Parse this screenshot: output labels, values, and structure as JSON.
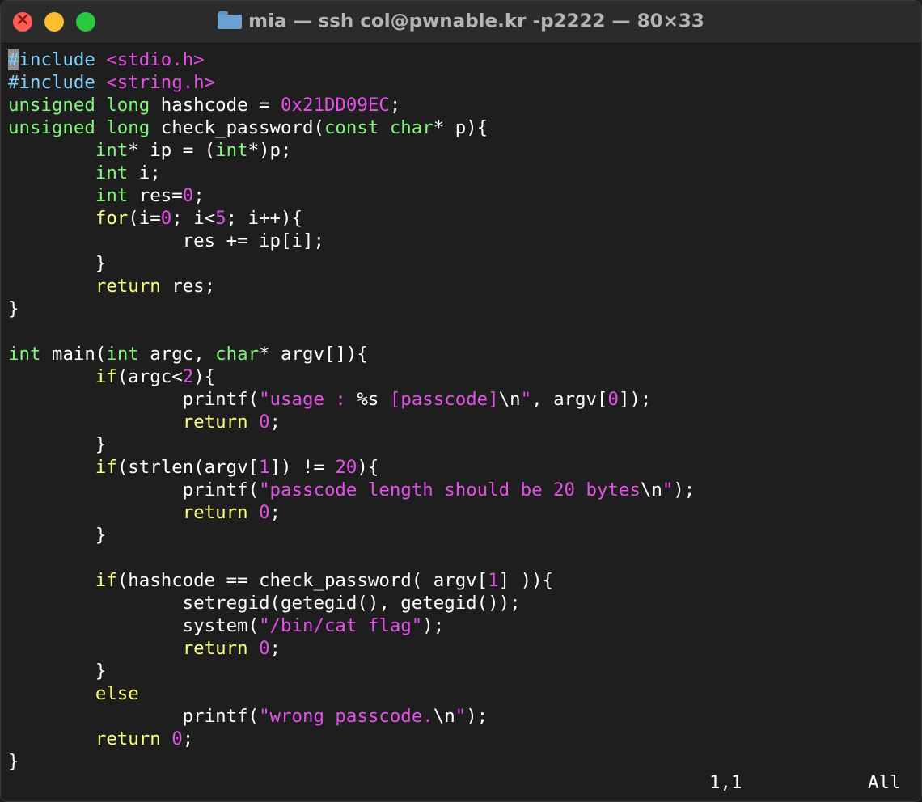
{
  "window": {
    "title": "mia — ssh col@pwnable.kr -p2222 — 80×33",
    "folder_icon": "folder-icon"
  },
  "colors": {
    "background": "#1e1e1e",
    "keyword": "#fbfd79",
    "type": "#7ff77b",
    "preprocessor": "#81d2ff",
    "string": "#e54fe9",
    "number": "#e54fe9"
  },
  "editor": {
    "cursor_char": "#",
    "lines": [
      [
        [
          "pp",
          "include "
        ],
        [
          "str",
          "<stdio.h>"
        ]
      ],
      [
        [
          "pp",
          "#include "
        ],
        [
          "str",
          "<string.h>"
        ]
      ],
      [
        [
          "ty",
          "unsigned long"
        ],
        [
          "n",
          " hashcode = "
        ],
        [
          "num",
          "0x21DD09EC"
        ],
        [
          "n",
          ";"
        ]
      ],
      [
        [
          "ty",
          "unsigned long"
        ],
        [
          "n",
          " check_password("
        ],
        [
          "ty",
          "const char"
        ],
        [
          "n",
          "* p){"
        ]
      ],
      [
        [
          "n",
          "        "
        ],
        [
          "ty",
          "int"
        ],
        [
          "n",
          "* ip = ("
        ],
        [
          "ty",
          "int"
        ],
        [
          "n",
          "*)p;"
        ]
      ],
      [
        [
          "n",
          "        "
        ],
        [
          "ty",
          "int"
        ],
        [
          "n",
          " i;"
        ]
      ],
      [
        [
          "n",
          "        "
        ],
        [
          "ty",
          "int"
        ],
        [
          "n",
          " res="
        ],
        [
          "num",
          "0"
        ],
        [
          "n",
          ";"
        ]
      ],
      [
        [
          "n",
          "        "
        ],
        [
          "kw",
          "for"
        ],
        [
          "n",
          "(i="
        ],
        [
          "num",
          "0"
        ],
        [
          "n",
          "; i<"
        ],
        [
          "num",
          "5"
        ],
        [
          "n",
          "; i++){"
        ]
      ],
      [
        [
          "n",
          "                res += ip[i];"
        ]
      ],
      [
        [
          "n",
          "        }"
        ]
      ],
      [
        [
          "n",
          "        "
        ],
        [
          "kw",
          "return"
        ],
        [
          "n",
          " res;"
        ]
      ],
      [
        [
          "n",
          "}"
        ]
      ],
      [],
      [
        [
          "ty",
          "int"
        ],
        [
          "n",
          " main("
        ],
        [
          "ty",
          "int"
        ],
        [
          "n",
          " argc, "
        ],
        [
          "ty",
          "char"
        ],
        [
          "n",
          "* argv[]){"
        ]
      ],
      [
        [
          "n",
          "        "
        ],
        [
          "kw",
          "if"
        ],
        [
          "n",
          "(argc<"
        ],
        [
          "num",
          "2"
        ],
        [
          "n",
          "){"
        ]
      ],
      [
        [
          "n",
          "                printf("
        ],
        [
          "str",
          "\"usage : "
        ],
        [
          "n",
          "%s"
        ],
        [
          "str",
          " [passcode]"
        ],
        [
          "n",
          "\\n"
        ],
        [
          "str",
          "\""
        ],
        [
          "n",
          ", argv["
        ],
        [
          "num",
          "0"
        ],
        [
          "n",
          "]);"
        ]
      ],
      [
        [
          "n",
          "                "
        ],
        [
          "kw",
          "return"
        ],
        [
          "n",
          " "
        ],
        [
          "num",
          "0"
        ],
        [
          "n",
          ";"
        ]
      ],
      [
        [
          "n",
          "        }"
        ]
      ],
      [
        [
          "n",
          "        "
        ],
        [
          "kw",
          "if"
        ],
        [
          "n",
          "(strlen(argv["
        ],
        [
          "num",
          "1"
        ],
        [
          "n",
          "]) != "
        ],
        [
          "num",
          "20"
        ],
        [
          "n",
          "){"
        ]
      ],
      [
        [
          "n",
          "                printf("
        ],
        [
          "str",
          "\"passcode length should be 20 bytes"
        ],
        [
          "n",
          "\\n"
        ],
        [
          "str",
          "\""
        ],
        [
          "n",
          ");"
        ]
      ],
      [
        [
          "n",
          "                "
        ],
        [
          "kw",
          "return"
        ],
        [
          "n",
          " "
        ],
        [
          "num",
          "0"
        ],
        [
          "n",
          ";"
        ]
      ],
      [
        [
          "n",
          "        }"
        ]
      ],
      [],
      [
        [
          "n",
          "        "
        ],
        [
          "kw",
          "if"
        ],
        [
          "n",
          "(hashcode == check_password( argv["
        ],
        [
          "num",
          "1"
        ],
        [
          "n",
          "] )){"
        ]
      ],
      [
        [
          "n",
          "                setregid(getegid(), getegid());"
        ]
      ],
      [
        [
          "n",
          "                system("
        ],
        [
          "str",
          "\"/bin/cat flag\""
        ],
        [
          "n",
          ");"
        ]
      ],
      [
        [
          "n",
          "                "
        ],
        [
          "kw",
          "return"
        ],
        [
          "n",
          " "
        ],
        [
          "num",
          "0"
        ],
        [
          "n",
          ";"
        ]
      ],
      [
        [
          "n",
          "        }"
        ]
      ],
      [
        [
          "n",
          "        "
        ],
        [
          "kw",
          "else"
        ]
      ],
      [
        [
          "n",
          "                printf("
        ],
        [
          "str",
          "\"wrong passcode."
        ],
        [
          "n",
          "\\n"
        ],
        [
          "str",
          "\""
        ],
        [
          "n",
          ");"
        ]
      ],
      [
        [
          "n",
          "        "
        ],
        [
          "kw",
          "return"
        ],
        [
          "n",
          " "
        ],
        [
          "num",
          "0"
        ],
        [
          "n",
          ";"
        ]
      ],
      [
        [
          "n",
          "}"
        ]
      ]
    ]
  },
  "status": {
    "cursor_position": "1,1",
    "scroll_indicator": "All"
  }
}
